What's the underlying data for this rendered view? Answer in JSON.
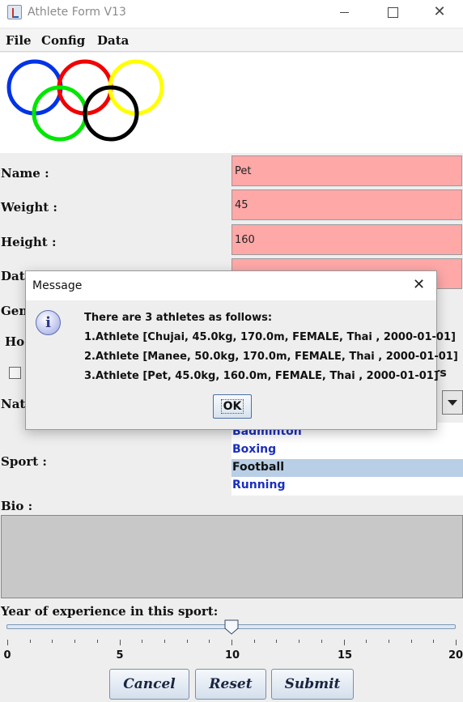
{
  "window": {
    "title": "Athlete Form V13",
    "close_glyph": "✕",
    "icon": "java-app-icon"
  },
  "menu": {
    "file": "File",
    "config": "Config",
    "data": "Data"
  },
  "logo": {
    "ring_colors": [
      "#0033e6",
      "#f20000",
      "#ffff00",
      "#00e600",
      "#000000"
    ]
  },
  "form": {
    "name_label": "Name :",
    "name_value": "Pet",
    "weight_label": "Weight :",
    "weight_value": "45",
    "height_label": "Height :",
    "height_value": "160",
    "date_label": "Date",
    "gender_label": "Gen",
    "hobbies_label": "Ho",
    "hobbies_fragment": "ers",
    "nationality_label": "Nati",
    "sport_label": "Sport :",
    "sports": [
      "Badminton",
      "Boxing",
      "Football",
      "Running"
    ],
    "sport_selected": "Football",
    "bio_label": "Bio :",
    "bio_value": "",
    "experience_label": "Year of experience in this sport:",
    "experience_value": 10,
    "experience_min": 0,
    "experience_max": 20,
    "slider_ticks": [
      "0",
      "5",
      "10",
      "15",
      "20"
    ]
  },
  "buttons": {
    "cancel": "Cancel",
    "reset": "Reset",
    "submit": "Submit"
  },
  "dialog": {
    "title": "Message",
    "close_glyph": "✕",
    "icon_glyph": "i",
    "lines": [
      "There are 3 athletes as follows:",
      "1.Athlete [Chujai, 45.0kg, 170.0m, FEMALE, Thai , 2000-01-01]",
      "2.Athlete [Manee, 50.0kg, 170.0m, FEMALE, Thai , 2000-01-01]",
      "3.Athlete [Pet, 45.0kg, 160.0m, FEMALE, Thai , 2000-01-01]"
    ],
    "ok": "OK"
  },
  "colors": {
    "field_required": "#ffa8a8",
    "list_selected": "#b8cfe5",
    "list_text": "#1a2fbf"
  }
}
